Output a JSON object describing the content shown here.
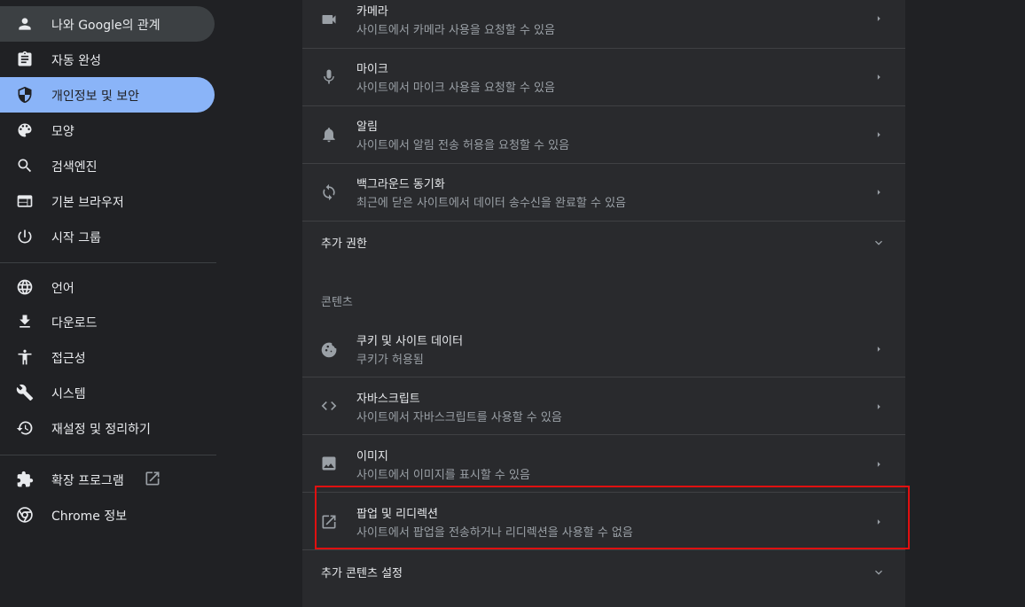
{
  "sidebar": {
    "items": [
      {
        "label": "나와 Google의 관계",
        "icon": "person-icon"
      },
      {
        "label": "자동 완성",
        "icon": "clipboard-icon"
      },
      {
        "label": "개인정보 및 보안",
        "icon": "shield-icon"
      },
      {
        "label": "모양",
        "icon": "palette-icon"
      },
      {
        "label": "검색엔진",
        "icon": "search-icon"
      },
      {
        "label": "기본 브라우저",
        "icon": "browser-window-icon"
      },
      {
        "label": "시작 그룹",
        "icon": "power-icon"
      },
      {
        "label": "언어",
        "icon": "globe-icon"
      },
      {
        "label": "다운로드",
        "icon": "download-icon"
      },
      {
        "label": "접근성",
        "icon": "accessibility-icon"
      },
      {
        "label": "시스템",
        "icon": "wrench-icon"
      },
      {
        "label": "재설정 및 정리하기",
        "icon": "history-reset-icon"
      },
      {
        "label": "확장 프로그램",
        "icon": "puzzle-icon"
      },
      {
        "label": "Chrome 정보",
        "icon": "chrome-icon"
      }
    ],
    "active_label": "개인정보 및 보안",
    "hovered_label": "나와 Google의 관계"
  },
  "permissions": [
    {
      "title": "카메라",
      "subtitle": "사이트에서 카메라 사용을 요청할 수 있음",
      "icon": "camera-icon"
    },
    {
      "title": "마이크",
      "subtitle": "사이트에서 마이크 사용을 요청할 수 있음",
      "icon": "microphone-icon"
    },
    {
      "title": "알림",
      "subtitle": "사이트에서 알림 전송 허용을 요청할 수 있음",
      "icon": "bell-icon"
    },
    {
      "title": "백그라운드 동기화",
      "subtitle": "최근에 닫은 사이트에서 데이터 송수신을 완료할 수 있음",
      "icon": "sync-icon"
    }
  ],
  "additional_permissions": "추가 권한",
  "content_section": {
    "title": "콘텐츠",
    "items": [
      {
        "title": "쿠키 및 사이트 데이터",
        "subtitle": "쿠키가 허용됨",
        "icon": "cookie-icon"
      },
      {
        "title": "자바스크립트",
        "subtitle": "사이트에서 자바스크립트를 사용할 수 있음",
        "icon": "code-icon"
      },
      {
        "title": "이미지",
        "subtitle": "사이트에서 이미지를 표시할 수 있음",
        "icon": "image-icon"
      },
      {
        "title": "팝업 및 리디렉션",
        "subtitle": "사이트에서 팝업을 전송하거나 리디렉션을 사용할 수 없음",
        "icon": "open-in-new-icon"
      }
    ]
  },
  "additional_content_settings": "추가 콘텐츠 설정",
  "colors": {
    "background": "#202124",
    "panel": "#292a2d",
    "accent": "#8ab4f8",
    "highlight_border": "#e01010"
  }
}
